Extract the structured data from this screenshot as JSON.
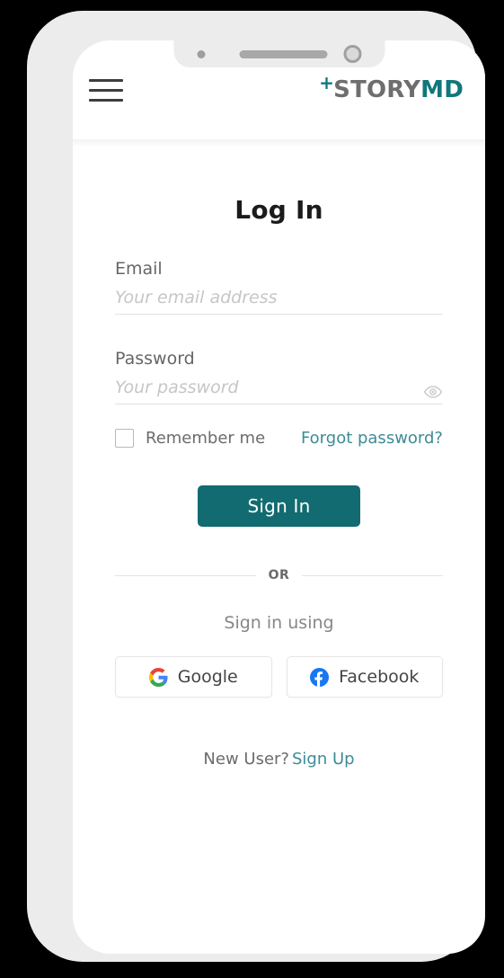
{
  "device": {
    "notch": {
      "sensor": "proximity-sensor",
      "speaker": "earpiece-speaker",
      "camera": "front-camera"
    },
    "buttons": [
      "silent-switch",
      "volume-up",
      "volume-down",
      "power"
    ]
  },
  "header": {
    "menu_icon": "hamburger-menu-icon",
    "logo": {
      "plus": "+",
      "story": "STORY",
      "md": "MD",
      "plus_color": "#0d7a80",
      "story_color": "#6e6e6e",
      "md_color": "#11767c"
    }
  },
  "form": {
    "title": "Log In",
    "email": {
      "label": "Email",
      "placeholder": "Your email address",
      "value": ""
    },
    "password": {
      "label": "Password",
      "placeholder": "Your password",
      "value": "",
      "toggle_icon": "eye-icon"
    },
    "remember_me": {
      "label": "Remember me",
      "checked": false
    },
    "forgot_password": "Forgot password?",
    "submit_label": "Sign In",
    "divider_label": "OR",
    "social_heading": "Sign in using",
    "social_buttons": [
      {
        "label": "Google",
        "icon": "google-icon"
      },
      {
        "label": "Facebook",
        "icon": "facebook-icon"
      }
    ],
    "footer": {
      "prompt": "New User?",
      "link": "Sign Up"
    }
  },
  "colors": {
    "primary_teal": "#126b70",
    "link_teal": "#3c8c95",
    "frame_gray": "#ececec",
    "screen_white": "#ffffff",
    "background": "#000000"
  }
}
